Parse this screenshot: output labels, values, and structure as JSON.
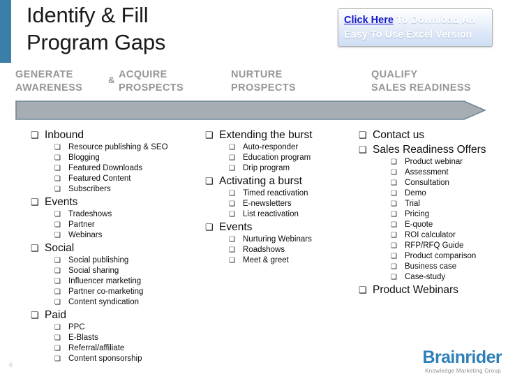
{
  "slide": {
    "title_lines": [
      "Identify & Fill",
      "Program Gaps"
    ],
    "page_number": "6",
    "accent_color": "#3b7ea8"
  },
  "cta": {
    "link_label": "Click Here",
    "line1_rest": " To Download An",
    "line2": "Easy To Use Excel Version",
    "link_color": "#1414c8",
    "text_color": "#ffffff"
  },
  "stages": [
    {
      "line1": "GENERATE",
      "line2": "AWARENESS"
    },
    {
      "line1": "ACQUIRE",
      "line2": "PROSPECTS"
    },
    {
      "line1": "NURTURE",
      "line2": "PROSPECTS"
    },
    {
      "line1": "QUALIFY",
      "line2": "SALES READINESS"
    }
  ],
  "stage_separator": "&",
  "arrow": {
    "fill_color": "#a7aeb3",
    "stroke_color": "#6f8796"
  },
  "columns": [
    {
      "groups": [
        {
          "label": "Inbound",
          "items": [
            "Resource publishing & SEO",
            "Blogging",
            "Featured Downloads",
            "Featured Content",
            "Subscribers"
          ]
        },
        {
          "label": "Events",
          "items": [
            "Tradeshows",
            "Partner",
            "Webinars"
          ]
        },
        {
          "label": "Social",
          "items": [
            "Social publishing",
            "Social sharing",
            "Influencer marketing",
            "Partner co-marketing",
            "Content syndication"
          ]
        },
        {
          "label": "Paid",
          "items": [
            "PPC",
            "E-Blasts",
            "Referral/affiliate",
            "Content sponsorship"
          ]
        }
      ]
    },
    {
      "groups": [
        {
          "label": "Extending the burst",
          "items": [
            "Auto-responder",
            "Education program",
            "Drip program"
          ]
        },
        {
          "label": "Activating a burst",
          "items": [
            "Timed reactivation",
            "E-newsletters",
            "List reactivation"
          ]
        },
        {
          "label": "Events",
          "items": [
            "Nurturing Webinars",
            "Roadshows",
            "Meet & greet"
          ]
        }
      ]
    },
    {
      "groups": [
        {
          "label": "Contact us",
          "items": []
        },
        {
          "label": "Sales Readiness Offers",
          "items": [
            "Product webinar",
            "Assessment",
            "Consultation",
            "Demo",
            "Trial",
            "Pricing",
            "E-quote",
            "ROI calculator",
            "RFP/RFQ Guide",
            "Product comparison",
            "Business case",
            "Case-study"
          ]
        },
        {
          "label": "Product Webinars",
          "items": []
        }
      ]
    }
  ],
  "bullets": {
    "level1": "❑",
    "level2": "❑"
  },
  "brand": {
    "name": "Brainrider",
    "tagline": "Knowledge Marketing Group",
    "color": "#2e7fb8"
  }
}
